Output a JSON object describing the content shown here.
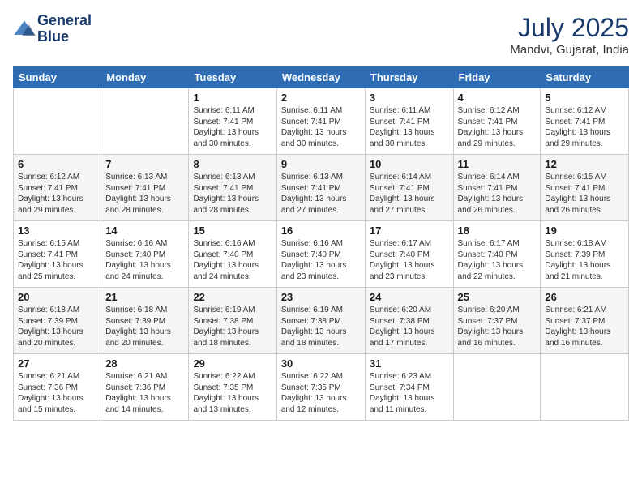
{
  "header": {
    "logo_line1": "General",
    "logo_line2": "Blue",
    "month": "July 2025",
    "location": "Mandvi, Gujarat, India"
  },
  "columns": [
    "Sunday",
    "Monday",
    "Tuesday",
    "Wednesday",
    "Thursday",
    "Friday",
    "Saturday"
  ],
  "rows": [
    [
      {
        "day": "",
        "info": ""
      },
      {
        "day": "",
        "info": ""
      },
      {
        "day": "1",
        "info": "Sunrise: 6:11 AM\nSunset: 7:41 PM\nDaylight: 13 hours and 30 minutes."
      },
      {
        "day": "2",
        "info": "Sunrise: 6:11 AM\nSunset: 7:41 PM\nDaylight: 13 hours and 30 minutes."
      },
      {
        "day": "3",
        "info": "Sunrise: 6:11 AM\nSunset: 7:41 PM\nDaylight: 13 hours and 30 minutes."
      },
      {
        "day": "4",
        "info": "Sunrise: 6:12 AM\nSunset: 7:41 PM\nDaylight: 13 hours and 29 minutes."
      },
      {
        "day": "5",
        "info": "Sunrise: 6:12 AM\nSunset: 7:41 PM\nDaylight: 13 hours and 29 minutes."
      }
    ],
    [
      {
        "day": "6",
        "info": "Sunrise: 6:12 AM\nSunset: 7:41 PM\nDaylight: 13 hours and 29 minutes."
      },
      {
        "day": "7",
        "info": "Sunrise: 6:13 AM\nSunset: 7:41 PM\nDaylight: 13 hours and 28 minutes."
      },
      {
        "day": "8",
        "info": "Sunrise: 6:13 AM\nSunset: 7:41 PM\nDaylight: 13 hours and 28 minutes."
      },
      {
        "day": "9",
        "info": "Sunrise: 6:13 AM\nSunset: 7:41 PM\nDaylight: 13 hours and 27 minutes."
      },
      {
        "day": "10",
        "info": "Sunrise: 6:14 AM\nSunset: 7:41 PM\nDaylight: 13 hours and 27 minutes."
      },
      {
        "day": "11",
        "info": "Sunrise: 6:14 AM\nSunset: 7:41 PM\nDaylight: 13 hours and 26 minutes."
      },
      {
        "day": "12",
        "info": "Sunrise: 6:15 AM\nSunset: 7:41 PM\nDaylight: 13 hours and 26 minutes."
      }
    ],
    [
      {
        "day": "13",
        "info": "Sunrise: 6:15 AM\nSunset: 7:41 PM\nDaylight: 13 hours and 25 minutes."
      },
      {
        "day": "14",
        "info": "Sunrise: 6:16 AM\nSunset: 7:40 PM\nDaylight: 13 hours and 24 minutes."
      },
      {
        "day": "15",
        "info": "Sunrise: 6:16 AM\nSunset: 7:40 PM\nDaylight: 13 hours and 24 minutes."
      },
      {
        "day": "16",
        "info": "Sunrise: 6:16 AM\nSunset: 7:40 PM\nDaylight: 13 hours and 23 minutes."
      },
      {
        "day": "17",
        "info": "Sunrise: 6:17 AM\nSunset: 7:40 PM\nDaylight: 13 hours and 23 minutes."
      },
      {
        "day": "18",
        "info": "Sunrise: 6:17 AM\nSunset: 7:40 PM\nDaylight: 13 hours and 22 minutes."
      },
      {
        "day": "19",
        "info": "Sunrise: 6:18 AM\nSunset: 7:39 PM\nDaylight: 13 hours and 21 minutes."
      }
    ],
    [
      {
        "day": "20",
        "info": "Sunrise: 6:18 AM\nSunset: 7:39 PM\nDaylight: 13 hours and 20 minutes."
      },
      {
        "day": "21",
        "info": "Sunrise: 6:18 AM\nSunset: 7:39 PM\nDaylight: 13 hours and 20 minutes."
      },
      {
        "day": "22",
        "info": "Sunrise: 6:19 AM\nSunset: 7:38 PM\nDaylight: 13 hours and 18 minutes."
      },
      {
        "day": "23",
        "info": "Sunrise: 6:19 AM\nSunset: 7:38 PM\nDaylight: 13 hours and 18 minutes."
      },
      {
        "day": "24",
        "info": "Sunrise: 6:20 AM\nSunset: 7:38 PM\nDaylight: 13 hours and 17 minutes."
      },
      {
        "day": "25",
        "info": "Sunrise: 6:20 AM\nSunset: 7:37 PM\nDaylight: 13 hours and 16 minutes."
      },
      {
        "day": "26",
        "info": "Sunrise: 6:21 AM\nSunset: 7:37 PM\nDaylight: 13 hours and 16 minutes."
      }
    ],
    [
      {
        "day": "27",
        "info": "Sunrise: 6:21 AM\nSunset: 7:36 PM\nDaylight: 13 hours and 15 minutes."
      },
      {
        "day": "28",
        "info": "Sunrise: 6:21 AM\nSunset: 7:36 PM\nDaylight: 13 hours and 14 minutes."
      },
      {
        "day": "29",
        "info": "Sunrise: 6:22 AM\nSunset: 7:35 PM\nDaylight: 13 hours and 13 minutes."
      },
      {
        "day": "30",
        "info": "Sunrise: 6:22 AM\nSunset: 7:35 PM\nDaylight: 13 hours and 12 minutes."
      },
      {
        "day": "31",
        "info": "Sunrise: 6:23 AM\nSunset: 7:34 PM\nDaylight: 13 hours and 11 minutes."
      },
      {
        "day": "",
        "info": ""
      },
      {
        "day": "",
        "info": ""
      }
    ]
  ]
}
